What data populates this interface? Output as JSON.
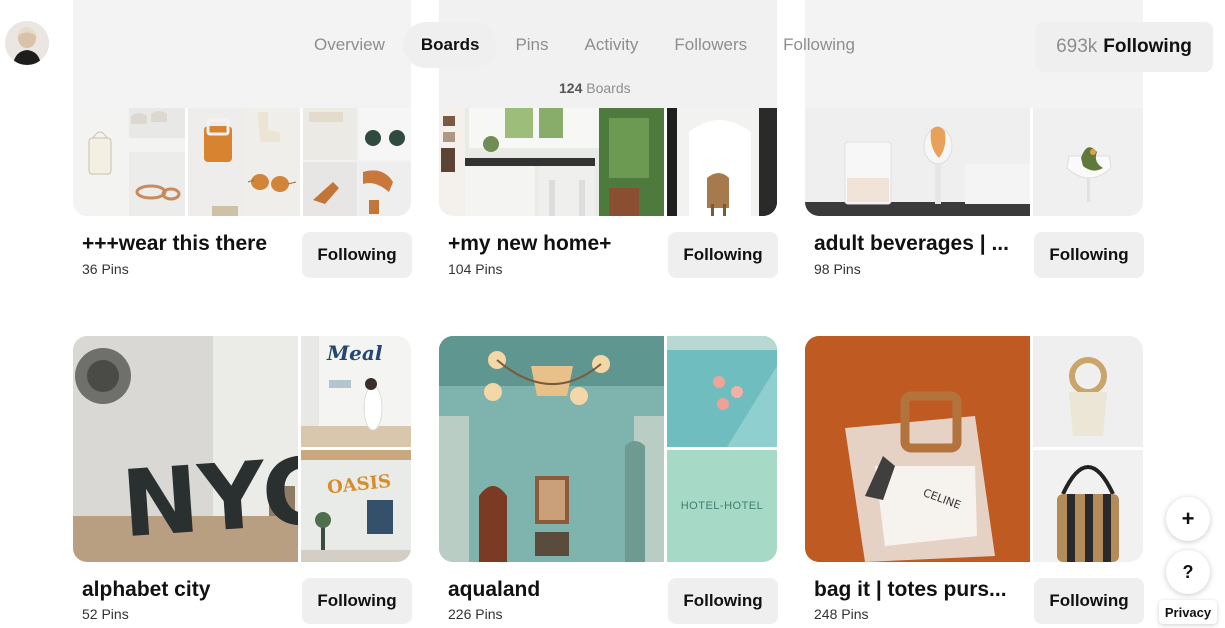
{
  "header": {
    "tabs": [
      {
        "label": "Overview"
      },
      {
        "label": "Boards"
      },
      {
        "label": "Pins"
      },
      {
        "label": "Activity"
      },
      {
        "label": "Followers"
      },
      {
        "label": "Following"
      }
    ],
    "active_tab": "Boards",
    "board_count": "124",
    "board_count_label": "Boards",
    "following_count": "693k",
    "following_label": "Following"
  },
  "boards": [
    {
      "title": "+++wear this there",
      "pins": "36 Pins",
      "button": "Following"
    },
    {
      "title": "+my new home+",
      "pins": "104 Pins",
      "button": "Following"
    },
    {
      "title": "adult beverages | ...",
      "pins": "98 Pins",
      "button": "Following"
    },
    {
      "title": "alphabet city",
      "pins": "52 Pins",
      "button": "Following"
    },
    {
      "title": "aqualand",
      "pins": "226 Pins",
      "button": "Following"
    },
    {
      "title": "bag it | totes purs...",
      "pins": "248 Pins",
      "button": "Following"
    }
  ],
  "cover_images": {
    "nyc_letters": "NYC",
    "meal_sign": "Meal",
    "oasis_sign": "OASIS",
    "hotel_sign": "HOTEL-HOTEL",
    "bag_text": "CELINE"
  },
  "floating": {
    "plus": "+",
    "help": "?",
    "privacy": "Privacy"
  },
  "colors": {
    "button_bg": "#efefef",
    "active_tab_bg": "#efefef",
    "muted_text": "#8e8e8e"
  }
}
